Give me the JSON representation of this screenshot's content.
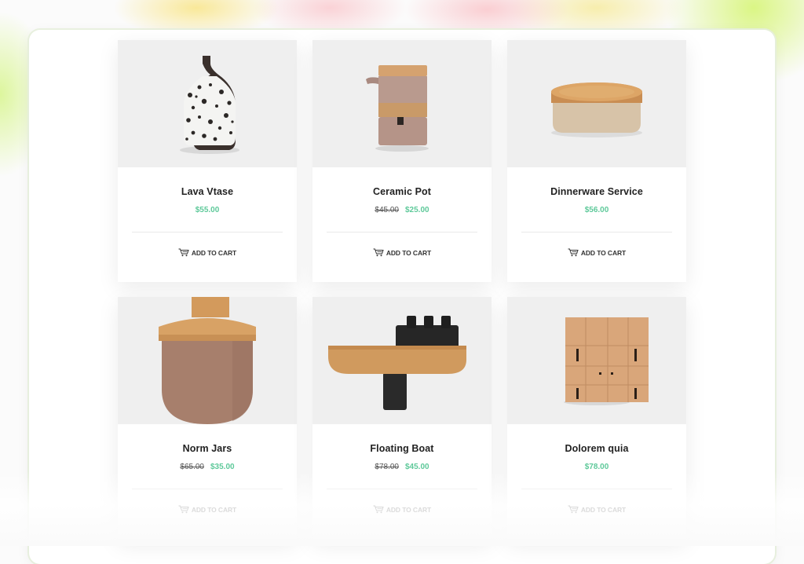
{
  "products": [
    {
      "name": "Lava Vtase",
      "old_price": "",
      "price": "$55.00",
      "cart_label": "ADD TO CART",
      "image_icon": "lava-vase-image"
    },
    {
      "name": "Ceramic Pot",
      "old_price": "$45.00",
      "price": "$25.00",
      "cart_label": "ADD TO CART",
      "image_icon": "ceramic-pot-image"
    },
    {
      "name": "Dinnerware Service",
      "old_price": "",
      "price": "$56.00",
      "cart_label": "ADD TO CART",
      "image_icon": "dinnerware-image"
    },
    {
      "name": "Norm Jars",
      "old_price": "$65.00",
      "price": "$35.00",
      "cart_label": "ADD TO CART",
      "image_icon": "norm-jar-image"
    },
    {
      "name": "Floating Boat",
      "old_price": "$78.00",
      "price": "$45.00",
      "cart_label": "ADD TO CART",
      "image_icon": "floating-boat-image"
    },
    {
      "name": "Dolorem quia",
      "old_price": "",
      "price": "$78.00",
      "cart_label": "ADD TO CART",
      "image_icon": "wooden-cube-robot-image"
    }
  ],
  "colors": {
    "accent": "#5ec99a",
    "text": "#222222",
    "image_bg": "#efefef"
  }
}
